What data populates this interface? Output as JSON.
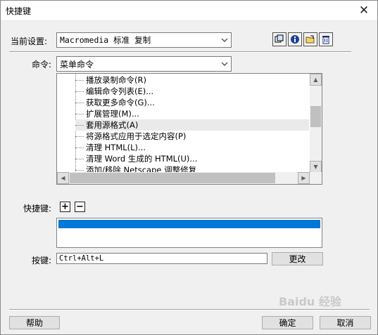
{
  "window": {
    "title": "快捷键"
  },
  "settings": {
    "label": "当前设置:",
    "value": "Macromedia 标准 复制"
  },
  "command": {
    "label": "命令:",
    "value": "菜单命令"
  },
  "command_list": {
    "items": [
      {
        "text": "播放录制命令(R)"
      },
      {
        "text": "编辑命令列表(E)..."
      },
      {
        "text": "获取更多命令(G)..."
      },
      {
        "text": "扩展管理(M)..."
      },
      {
        "text": "套用源格式(A)"
      },
      {
        "text": "将源格式应用于选定内容(P)"
      },
      {
        "text": "清理 HTML(L)..."
      },
      {
        "text": "清理 Word 生成的 HTML(U)..."
      },
      {
        "text": "添加/移除 Netscape 调整修复"
      }
    ],
    "selected_index": 4
  },
  "shortcut": {
    "label": "快捷键:",
    "add": "+",
    "remove": "−"
  },
  "key": {
    "label": "按键:",
    "value": "Ctrl+Alt+L",
    "change_button": "更改"
  },
  "footer": {
    "help": "帮助",
    "ok": "确定",
    "cancel": "取消"
  },
  "watermark": {
    "text": "Baidu 经验"
  },
  "colors": {
    "selection": "#0078d7",
    "dialog_bg": "#f0f0f0"
  }
}
